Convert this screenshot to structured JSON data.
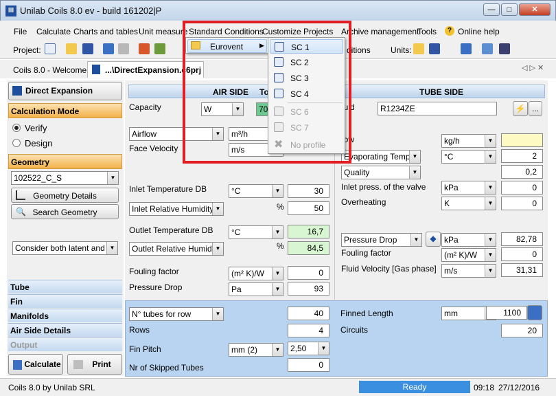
{
  "window": {
    "title": "Unilab Coils 8.0 ev - build 161202|P",
    "app_icon": "III"
  },
  "menu": {
    "file": "File",
    "calculate": "Calculate",
    "charts": "Charts and tables",
    "unit_measure": "Unit measure",
    "standard_conditions": "Standard Conditions",
    "customize": "Customize",
    "projects": "Projects",
    "archive": "Archive management",
    "tools": "Tools",
    "online_help": "Online help"
  },
  "toolbar": {
    "project_label": "Project:",
    "conditions_label": "ditions",
    "units_label": "Units:"
  },
  "tabs": {
    "welcome": "Coils 8.0 - Welcome!",
    "active": "...\\DirectExpansion.c6prj"
  },
  "sidebar": {
    "title": "Direct Expansion",
    "calc_mode": "Calculation Mode",
    "verify": "Verify",
    "design": "Design",
    "geometry": "Geometry",
    "geometry_value": "102522_C_S",
    "geometry_details": "Geometry Details",
    "search_geometry": "Search Geometry",
    "latent_option": "Consider both latent and se",
    "sections": [
      "Tube",
      "Fin",
      "Manifolds",
      "Air Side Details",
      "Output"
    ],
    "calculate": "Calculate",
    "print": "Print"
  },
  "air": {
    "header": "AIR SIDE",
    "to_header": "To",
    "capacity_label": "Capacity",
    "capacity_unit": "W",
    "capacity_value": "70",
    "airflow": "Airflow",
    "airflow_unit": "m³/h",
    "face_velocity": "Face Velocity",
    "face_velocity_unit": "m/s",
    "inlet_temp": "Inlet Temperature DB",
    "inlet_temp_unit": "°C",
    "inlet_temp_value": "30",
    "inlet_rh": "Inlet Relative Humidity",
    "percent": "%",
    "inlet_rh_value": "50",
    "outlet_temp": "Outlet Temperature DB",
    "outlet_temp_unit": "°C",
    "outlet_temp_value": "16,7",
    "outlet_rh": "Outlet Relative Humidity",
    "outlet_rh_value": "84,5",
    "fouling": "Fouling factor",
    "fouling_unit": "(m² K)/W",
    "fouling_value": "0",
    "pressure_drop": "Pressure Drop",
    "pressure_drop_unit": "Pa",
    "pressure_drop_value": "93"
  },
  "tube": {
    "header": "TUBE SIDE",
    "fluid_label": "luid",
    "fluid_value": "R1234ZE",
    "flow_label": "low",
    "flow_unit": "kg/h",
    "evap_temp": "Evaporating Temp.",
    "evap_unit": "°C",
    "evap_value": "2",
    "quality": "Quality",
    "quality_value": "0,2",
    "inlet_press": "Inlet press. of the valve",
    "inlet_press_unit": "kPa",
    "inlet_press_value": "0",
    "overheating": "Overheating",
    "overheating_unit": "K",
    "overheating_value": "0",
    "pressure_drop": "Pressure Drop",
    "pressure_drop_unit": "kPa",
    "pressure_drop_value": "82,78",
    "fouling": "Fouling factor",
    "fouling_unit": "(m² K)/W",
    "fouling_value": "0",
    "fluid_velocity": "Fluid Velocity [Gas phase]",
    "fluid_velocity_unit": "m/s",
    "fluid_velocity_value": "31,31"
  },
  "geom": {
    "tubes_for_row": "N° tubes for row",
    "tubes_for_row_value": "40",
    "rows": "Rows",
    "rows_value": "4",
    "fin_pitch": "Fin Pitch",
    "fin_pitch_unit": "mm (2)",
    "fin_pitch_value": "2,50",
    "skipped": "Nr of Skipped Tubes",
    "skipped_value": "0",
    "finned_length": "Finned Length",
    "finned_length_unit": "mm",
    "finned_length_value": "1100",
    "circuits": "Circuits",
    "circuits_value": "20"
  },
  "dropdown": {
    "eurovent": "Eurovent",
    "items": [
      "SC 1",
      "SC 2",
      "SC 3",
      "SC 4",
      "SC 6",
      "SC 7",
      "No profile"
    ]
  },
  "status": {
    "left": "Coils 8.0  by Unilab SRL",
    "ready": "Ready",
    "time": "09:18",
    "date": "27/12/2016"
  }
}
